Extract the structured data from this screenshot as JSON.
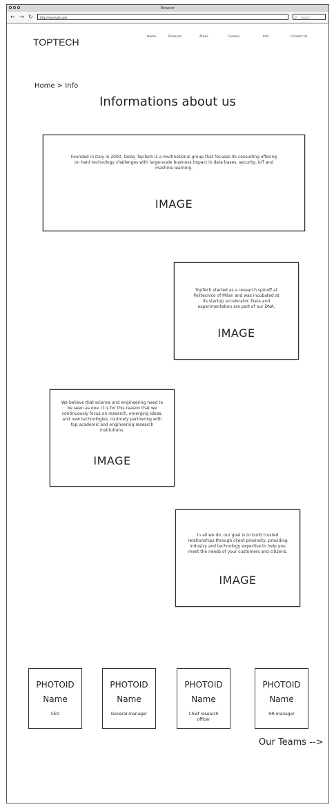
{
  "browser": {
    "title": "Browser",
    "back_icon": "←",
    "forward_icon": "→",
    "reload_icon": "↻",
    "url": "http://example.com",
    "search_placeholder": "Search"
  },
  "header": {
    "logo": "TOPTECH",
    "nav": [
      "Home",
      "Products",
      "Areas",
      "Careers",
      "Info",
      "Contact Us"
    ]
  },
  "breadcrumb": "Home > Info",
  "page_title": "Informations about us",
  "sections": [
    {
      "text": "Founded in Italy in 2000, today TopTech is a multinational group that focuses its consulting offering on hard technology challenges with large-scale business impact in data bases, security, IoT and machine learning.",
      "image_label": "IMAGE"
    },
    {
      "text": "TopTech started as a research spinoff at Politecnico of Milan and was incubated at its startup accelerator. Data and experimentation are part of our DNA.",
      "image_label": "IMAGE"
    },
    {
      "text": "We believe that science and engineering need to be seen as one. It is for this reason that we continuously focus on research, emerging ideas, and new technologies, routinely partnering with top academic and engineering research institutions.",
      "image_label": "IMAGE"
    },
    {
      "text": "In all we do, our goal is to build trusted relationships through client proximity, providing industry and technology expertise to help you meet the needs of your customers and citizens.",
      "image_label": "IMAGE"
    }
  ],
  "team": [
    {
      "photo": "PHOTOID",
      "name": "Name",
      "role": "CEO"
    },
    {
      "photo": "PHOTOID",
      "name": "Name",
      "role": "General manager"
    },
    {
      "photo": "PHOTOID",
      "name": "Name",
      "role": "Chief research officer"
    },
    {
      "photo": "PHOTOID",
      "name": "Name",
      "role": "HR manager"
    }
  ],
  "our_teams_link": "Our Teams -->"
}
